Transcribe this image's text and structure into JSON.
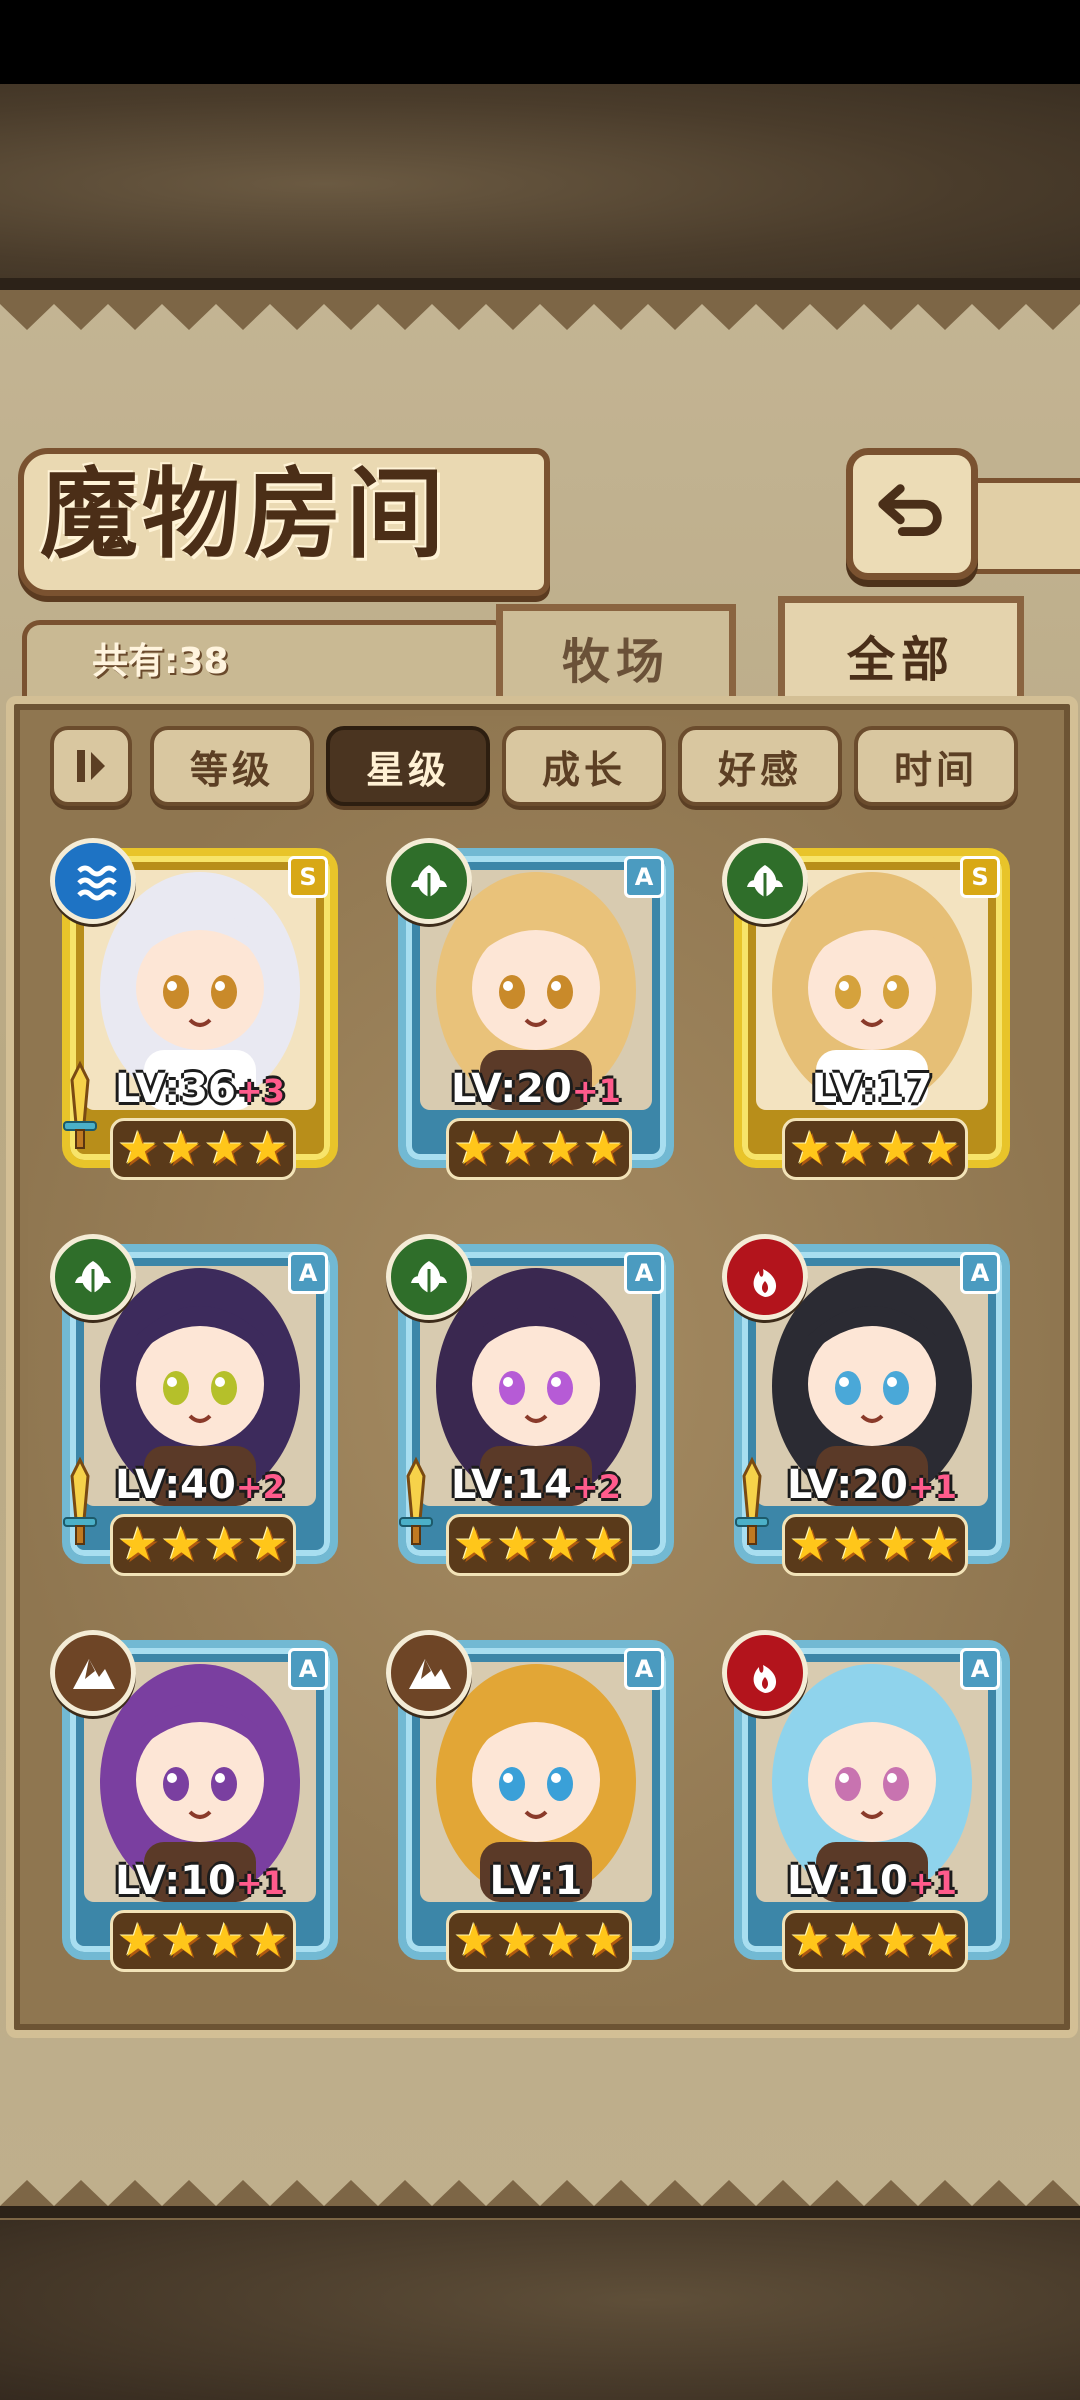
{
  "title": "魔物房间",
  "count_label": "共有:38",
  "tabs": [
    {
      "label": "牧场",
      "active": false
    },
    {
      "label": "全部",
      "active": true
    }
  ],
  "filters": [
    {
      "label": "等级",
      "active": false
    },
    {
      "label": "星级",
      "active": true
    },
    {
      "label": "成长",
      "active": false
    },
    {
      "label": "好感",
      "active": false
    },
    {
      "label": "时间",
      "active": false
    }
  ],
  "monsters": [
    {
      "lv": "LV:36",
      "plus": "+3",
      "rank": "S",
      "frame": "gold",
      "element": "water",
      "equipped": true,
      "stars": 4,
      "hair": "#e9e9f2"
    },
    {
      "lv": "LV:20",
      "plus": "+1",
      "rank": "A",
      "frame": "blue",
      "element": "leaf",
      "equipped": false,
      "stars": 4,
      "hair": "#e9c27a"
    },
    {
      "lv": "LV:17",
      "plus": "",
      "rank": "S",
      "frame": "gold",
      "element": "leaf",
      "equipped": false,
      "stars": 4,
      "hair": "#e6bf76"
    },
    {
      "lv": "LV:40",
      "plus": "+2",
      "rank": "A",
      "frame": "blue",
      "element": "leaf",
      "equipped": true,
      "stars": 4,
      "hair": "#3d2b5c"
    },
    {
      "lv": "LV:14",
      "plus": "+2",
      "rank": "A",
      "frame": "blue",
      "element": "leaf",
      "equipped": true,
      "stars": 4,
      "hair": "#3a2850"
    },
    {
      "lv": "LV:20",
      "plus": "+1",
      "rank": "A",
      "frame": "blue",
      "element": "fire",
      "equipped": true,
      "stars": 4,
      "hair": "#2b2b33"
    },
    {
      "lv": "LV:10",
      "plus": "+1",
      "rank": "A",
      "frame": "blue",
      "element": "earth",
      "equipped": false,
      "stars": 4,
      "hair": "#7a3fa0"
    },
    {
      "lv": "LV:1",
      "plus": "",
      "rank": "A",
      "frame": "blue",
      "element": "earth",
      "equipped": false,
      "stars": 4,
      "hair": "#e2a636"
    },
    {
      "lv": "LV:10",
      "plus": "+1",
      "rank": "A",
      "frame": "blue",
      "element": "fire",
      "equipped": false,
      "stars": 4,
      "hair": "#8fd3ec"
    }
  ],
  "icons": {
    "back": "back-arrow-icon",
    "sort_toggle": "sort-toggle-icon",
    "elements": [
      "water-element-icon",
      "leaf-element-icon",
      "fire-element-icon",
      "earth-element-icon"
    ],
    "equipment": "sword-icon",
    "star": "star-icon"
  }
}
